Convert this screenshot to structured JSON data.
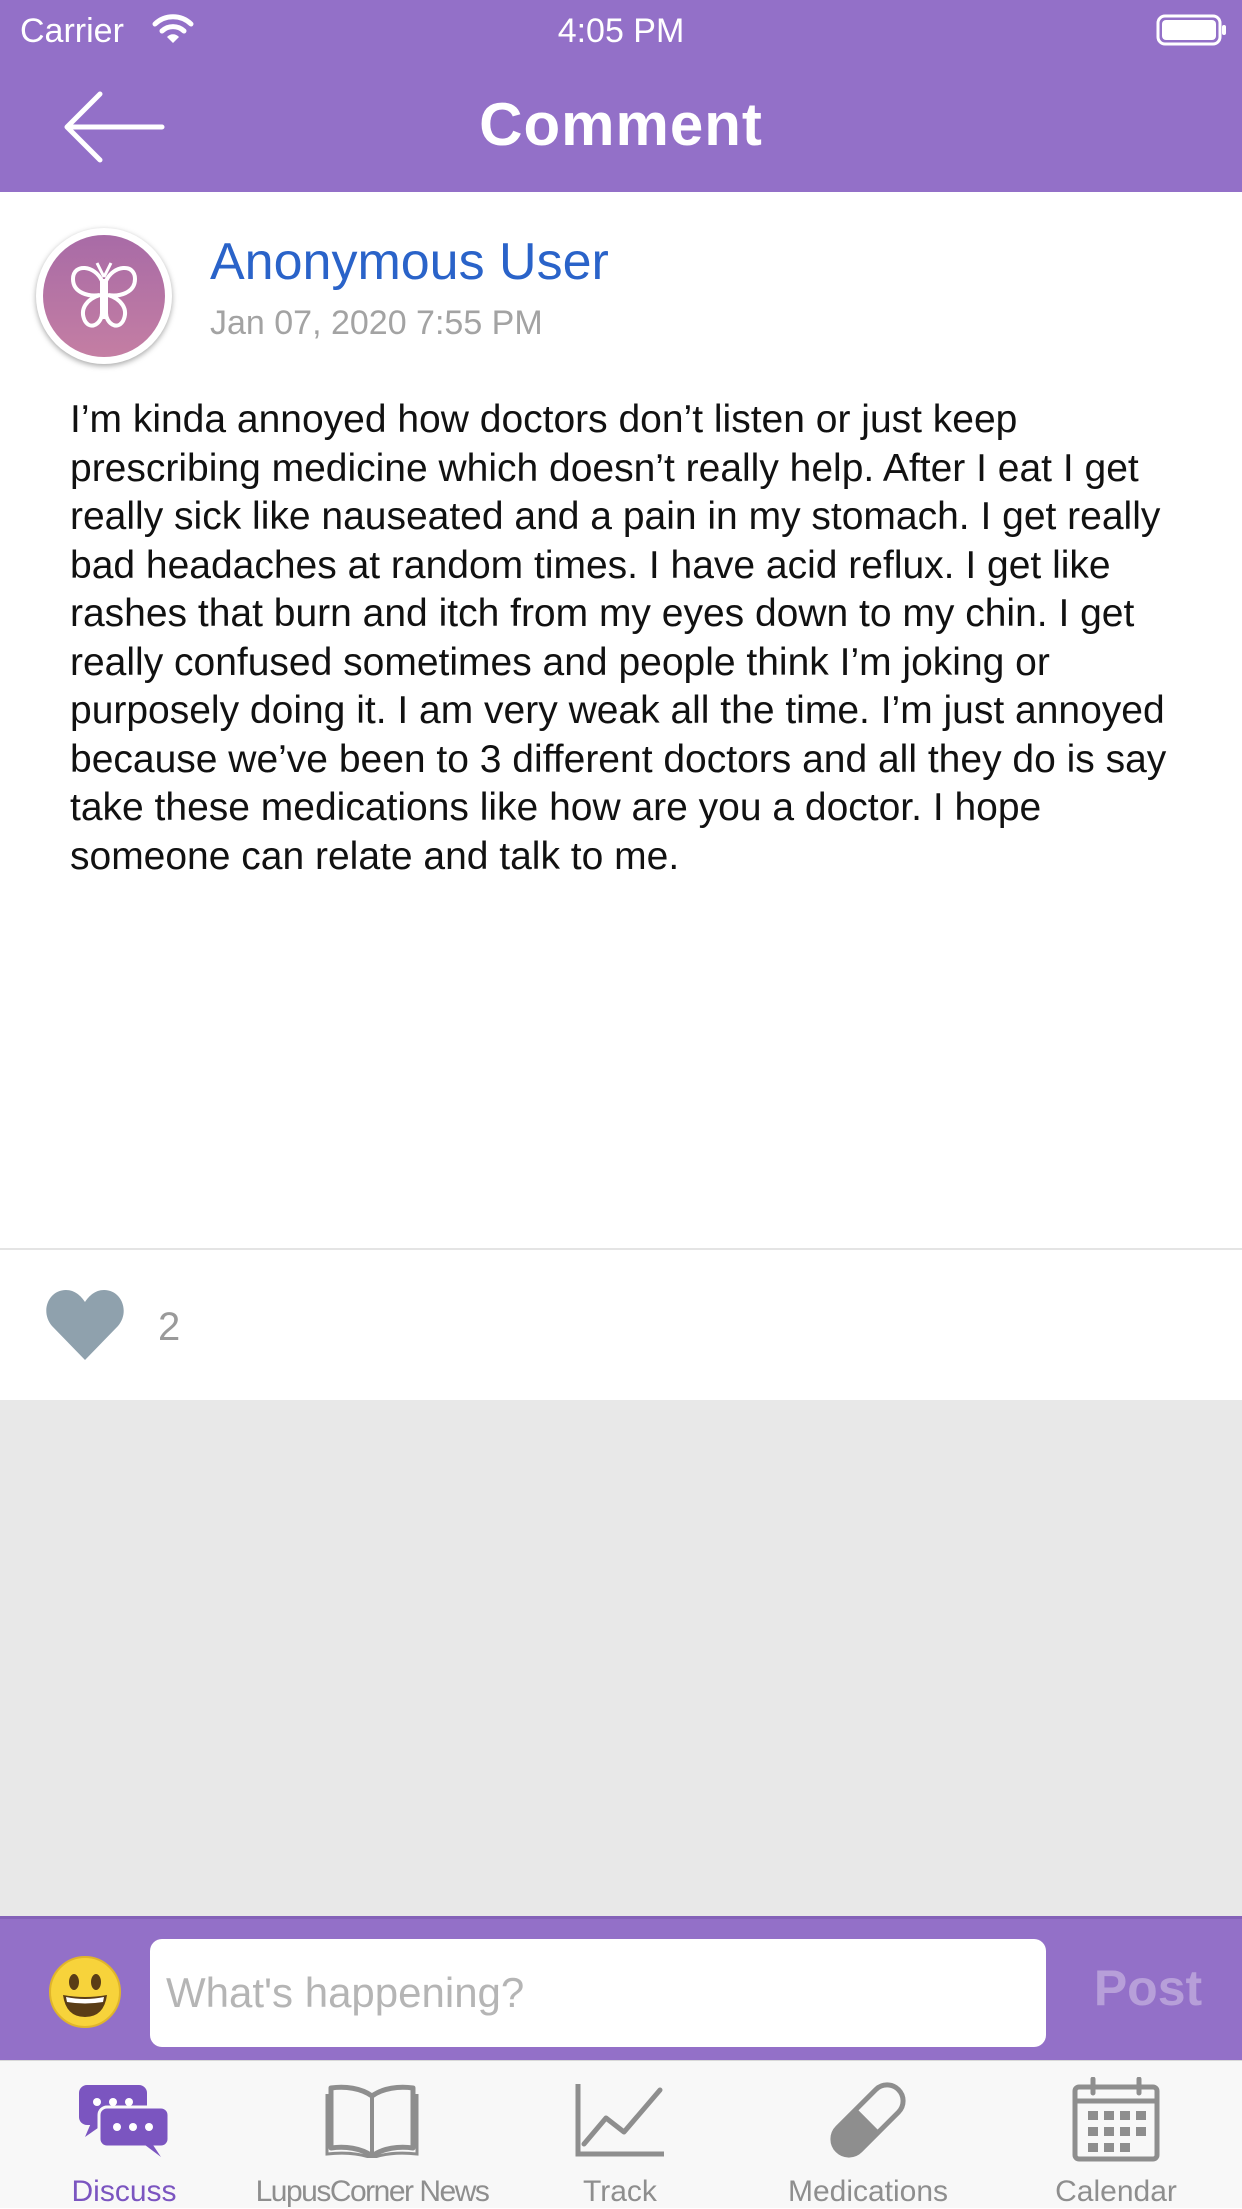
{
  "status_bar": {
    "carrier": "Carrier",
    "time": "4:05 PM"
  },
  "nav": {
    "title": "Comment",
    "back_icon": "arrow-left-icon"
  },
  "post": {
    "author": "Anonymous User",
    "date": "Jan 07, 2020 7:55 PM",
    "avatar_icon": "butterfly-icon",
    "body": "I’m kinda annoyed how doctors don’t listen or just keep prescribing medicine which doesn’t really help. After I eat I get really sick like nauseated and a pain in my stomach. I get really bad headaches at random times. I have acid reflux. I get like rashes that burn and itch from my eyes down to my chin. I get really confused sometimes and people think I’m joking or purposely doing it. I am very weak all the time. I’m just annoyed because we’ve been to 3 different doctors and all they do is say take these medications like how are you a doctor. I hope someone can relate and talk to me.",
    "likes": "2"
  },
  "composer": {
    "placeholder": "What's happening?",
    "value": "",
    "post_label": "Post",
    "emoji_icon": "smiley-icon"
  },
  "tabs": [
    {
      "label": "Discuss",
      "icon": "chat-bubbles-icon",
      "active": true
    },
    {
      "label": "LupusCorner News",
      "icon": "book-icon",
      "active": false
    },
    {
      "label": "Track",
      "icon": "line-chart-icon",
      "active": false
    },
    {
      "label": "Medications",
      "icon": "pill-icon",
      "active": false
    },
    {
      "label": "Calendar",
      "icon": "calendar-icon",
      "active": false
    }
  ],
  "colors": {
    "header": "#9370c8",
    "author": "#2a63c9",
    "active_tab": "#7b55c0",
    "inactive_tab": "#8e8e8e"
  }
}
